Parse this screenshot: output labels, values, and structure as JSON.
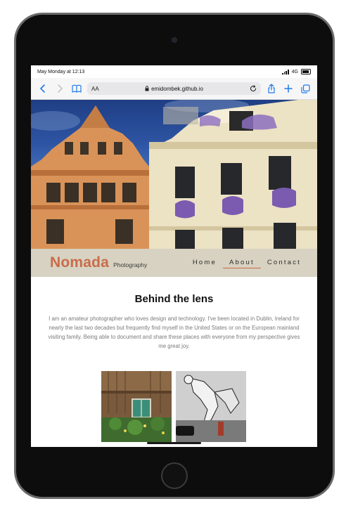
{
  "status_bar": {
    "time": "May Monday at 12:13",
    "network": "4G"
  },
  "browser": {
    "text_size_label": "AA",
    "url": "emidombek.github.io"
  },
  "site": {
    "brand": "Nomada",
    "brand_sub": "Photography",
    "nav": [
      {
        "label": "Home",
        "active": false
      },
      {
        "label": "About",
        "active": true
      },
      {
        "label": "Contact",
        "active": false
      }
    ]
  },
  "about": {
    "title": "Behind the lens",
    "body": "I am an amateur photographer who loves design and technology. I've been located in Dublin, Ireland for nearly the last two decades but frequently find myself in the United States or on the European mainland visiting family. Being able to document and share these places with everyone from my perspective gives me great joy."
  },
  "colors": {
    "accent": "#c96c4c",
    "nav_bg": "#d7d2c1",
    "link": "#1f7ae8"
  },
  "icons": [
    "back-icon",
    "forward-icon",
    "bookmarks-icon",
    "lock-icon",
    "reload-icon",
    "share-icon",
    "new-tab-icon",
    "tabs-icon"
  ]
}
